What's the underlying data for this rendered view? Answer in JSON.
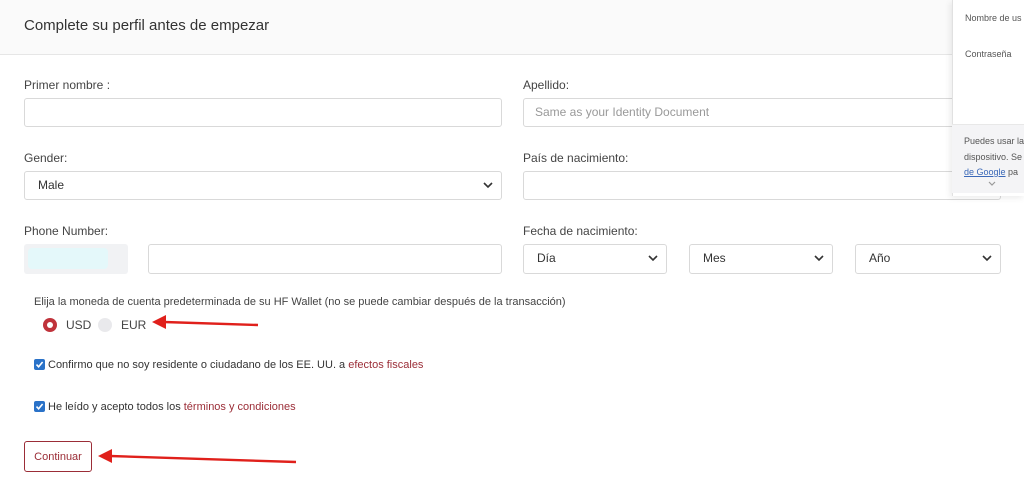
{
  "header": {
    "title": "Complete su perfil antes de empezar"
  },
  "form": {
    "first_name": {
      "label": "Primer nombre :",
      "value": ""
    },
    "last_name": {
      "label": "Apellido:",
      "placeholder": "Same as your Identity Document"
    },
    "gender": {
      "label": "Gender:",
      "selected": "Male"
    },
    "birth_country": {
      "label": "País de nacimiento:",
      "value": ""
    },
    "phone": {
      "label": "Phone Number:",
      "value": ""
    },
    "birth_date": {
      "label": "Fecha de nacimiento:",
      "day": "Día",
      "month": "Mes",
      "year": "Año"
    },
    "currency": {
      "label": "Elija la moneda de cuenta predeterminada de su HF Wallet (no se puede cambiar después de la transacción)",
      "options": [
        "USD",
        "EUR"
      ],
      "selected": "USD"
    },
    "residency_check": {
      "text": "Confirmo que no soy residente o ciudadano de los EE. UU. a ",
      "link": "efectos fiscales",
      "checked": true
    },
    "terms_check": {
      "text": "He leído y acepto todos los ",
      "link": "términos y condiciones",
      "checked": true
    },
    "submit_label": "Continuar"
  },
  "popup": {
    "username_label": "Nombre de us",
    "password_label": "Contraseña",
    "note_line1": "Puedes usar la",
    "note_line2": "dispositivo. Se",
    "note_link": "de Google",
    "note_line3_tail": " pa"
  },
  "colors": {
    "accent": "#9b2d37",
    "radio": "#c0333b",
    "checkbox": "#2a72c8",
    "arrow": "#e0201b"
  }
}
